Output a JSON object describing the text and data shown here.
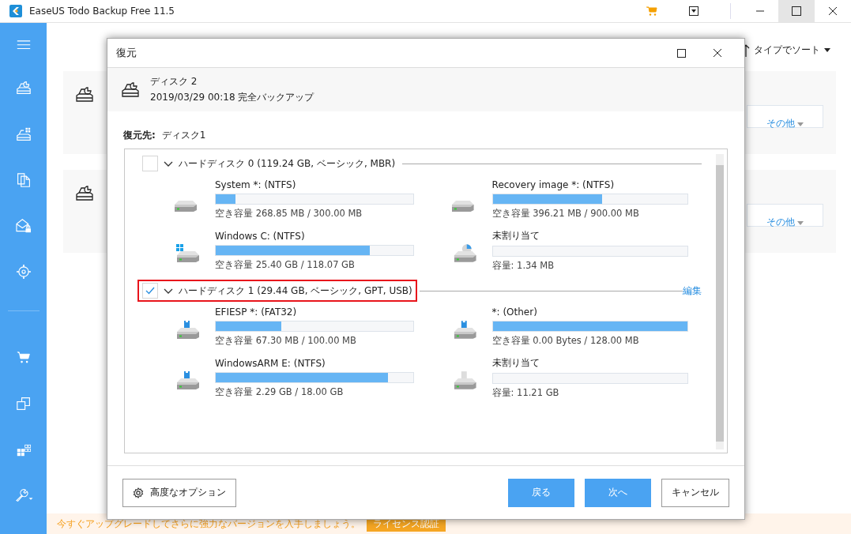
{
  "window": {
    "title": "EaseUS Todo Backup Free 11.5"
  },
  "background": {
    "sort_label": "タイプでソート",
    "cards": [
      {
        "more_button": "その他"
      },
      {
        "more_button": "その他"
      }
    ]
  },
  "upgrade_bar": {
    "message": "今すぐアップグレードしてさらに強力なバージョンを入手しましょう。",
    "button": "ライセンス認証"
  },
  "dialog": {
    "title": "復元",
    "source": {
      "name": "ディスク 2",
      "detail": "2019/03/29 00:18 完全バックアップ"
    },
    "target_label": "復元先:",
    "target_value": "ディスク1",
    "disks": [
      {
        "label": "ハードディスク 0 (119.24 GB, ベーシック, MBR)",
        "checked": false,
        "highlighted": false,
        "partitions": [
          {
            "kind": "drive",
            "name": "System *: (NTFS)",
            "level": 0.1,
            "info": "空き容量 268.85 MB / 300.00 MB"
          },
          {
            "kind": "drive",
            "name": "Recovery image *: (NTFS)",
            "level": 0.56,
            "info": "空き容量 396.21 MB / 900.00 MB"
          },
          {
            "kind": "windows",
            "name": "Windows C: (NTFS)",
            "level": 0.78,
            "info": "空き容量 25.40 GB / 118.07 GB"
          },
          {
            "kind": "unallocated",
            "name": "未割り当て",
            "level": 0,
            "info": "容量: 1.34 MB"
          }
        ]
      },
      {
        "label": "ハードディスク 1 (29.44 GB, ベーシック, GPT, USB)",
        "checked": true,
        "highlighted": true,
        "edit_link": "編集",
        "partitions": [
          {
            "kind": "usb",
            "name": "EFIESP *: (FAT32)",
            "level": 0.33,
            "info": "空き容量 67.30 MB / 100.00 MB"
          },
          {
            "kind": "usb",
            "name": "*: (Other)",
            "level": 1,
            "info": "空き容量 0.00 Bytes / 128.00 MB"
          },
          {
            "kind": "usb",
            "name": "WindowsARM E: (NTFS)",
            "level": 0.87,
            "info": "空き容量 2.29 GB / 18.00 GB"
          },
          {
            "kind": "usb-gray",
            "name": "未割り当て",
            "level": 0,
            "info": "容量: 11.21 GB"
          }
        ]
      }
    ],
    "advanced_button": "高度なオプション",
    "buttons": [
      "戻る",
      "次へ",
      "キャンセル"
    ]
  }
}
